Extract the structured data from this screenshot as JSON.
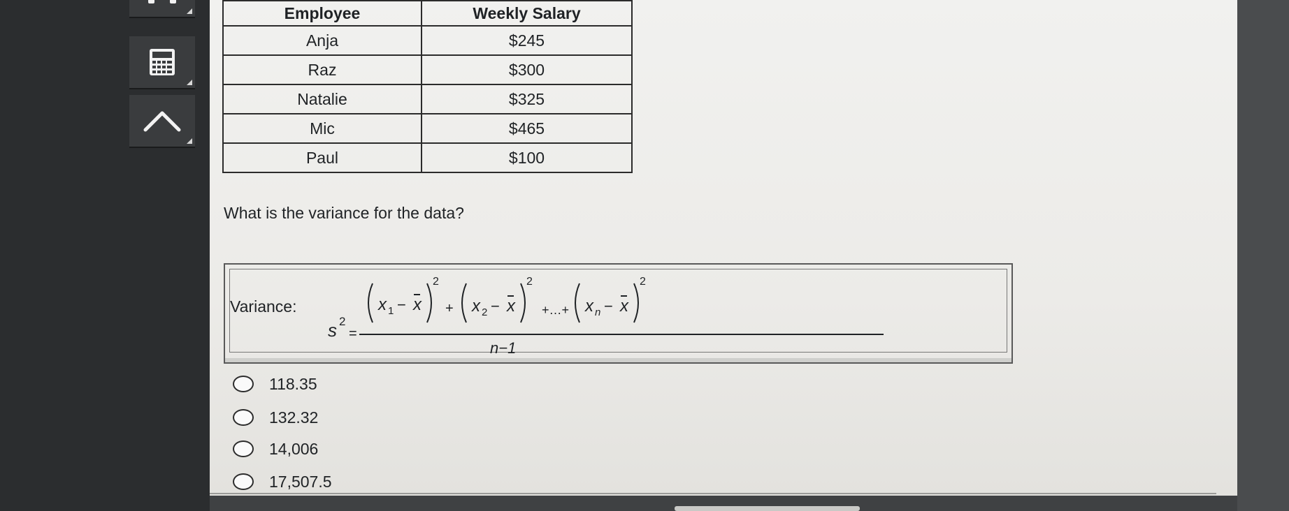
{
  "table": {
    "headers": [
      "Employee",
      "Weekly Salary"
    ],
    "rows": [
      {
        "employee": "Anja",
        "salary": "$245"
      },
      {
        "employee": "Raz",
        "salary": "$300"
      },
      {
        "employee": "Natalie",
        "salary": "$325"
      },
      {
        "employee": "Mic",
        "salary": "$465"
      },
      {
        "employee": "Paul",
        "salary": "$100"
      }
    ]
  },
  "question": "What is the variance for the data?",
  "formula": {
    "label": "Variance:",
    "lhs": "s",
    "exp": "2",
    "eq": "=",
    "x": "x",
    "sub1": "1",
    "sub2": "2",
    "subn": "n",
    "minus": "−",
    "plus": "+",
    "ellipsis": "+…+",
    "denominator": "n−1"
  },
  "options": [
    "118.35",
    "132.32",
    "14,006",
    "17,507.5"
  ],
  "icons": [
    "headphones-icon",
    "calculator-icon",
    "collapse-up-icon"
  ]
}
